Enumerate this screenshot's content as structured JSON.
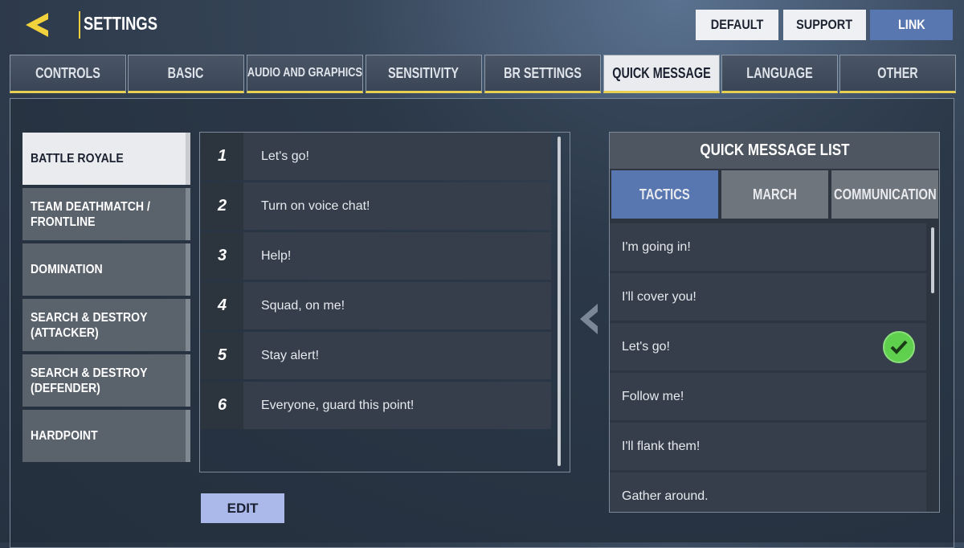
{
  "header": {
    "title": "SETTINGS",
    "back_icon": "chevron-left-icon",
    "accent": "#f2d23c"
  },
  "top_buttons": [
    {
      "label": "DEFAULT"
    },
    {
      "label": "SUPPORT"
    },
    {
      "label": "LINK",
      "color": "#5876b0"
    }
  ],
  "tabs": [
    {
      "label": "CONTROLS"
    },
    {
      "label": "BASIC"
    },
    {
      "label": "AUDIO AND GRAPHICS"
    },
    {
      "label": "SENSITIVITY"
    },
    {
      "label": "BR SETTINGS"
    },
    {
      "label": "QUICK MESSAGE",
      "active": true
    },
    {
      "label": "LANGUAGE"
    },
    {
      "label": "OTHER"
    }
  ],
  "modes": [
    {
      "label": "BATTLE ROYALE",
      "active": true
    },
    {
      "label": "TEAM DEATHMATCH / FRONTLINE"
    },
    {
      "label": "DOMINATION"
    },
    {
      "label": "SEARCH & DESTROY (ATTACKER)"
    },
    {
      "label": "SEARCH & DESTROY (DEFENDER)"
    },
    {
      "label": "HARDPOINT"
    }
  ],
  "slots": [
    {
      "num": "1",
      "text": "Let's go!"
    },
    {
      "num": "2",
      "text": "Turn on voice chat!"
    },
    {
      "num": "3",
      "text": "Help!"
    },
    {
      "num": "4",
      "text": "Squad, on me!"
    },
    {
      "num": "5",
      "text": "Stay alert!"
    },
    {
      "num": "6",
      "text": "Everyone, guard this point!"
    }
  ],
  "edit_label": "EDIT",
  "quick_list": {
    "title": "QUICK MESSAGE LIST",
    "tabs": [
      {
        "label": "TACTICS",
        "active": true
      },
      {
        "label": "MARCH"
      },
      {
        "label": "COMMUNICATION"
      }
    ],
    "items": [
      {
        "text": "I'm going in!"
      },
      {
        "text": "I'll cover you!"
      },
      {
        "text": "Let's go!",
        "selected": true
      },
      {
        "text": "Follow me!"
      },
      {
        "text": "I'll flank them!"
      },
      {
        "text": "Gather around."
      }
    ],
    "selected_color": "#5fcf4e"
  }
}
